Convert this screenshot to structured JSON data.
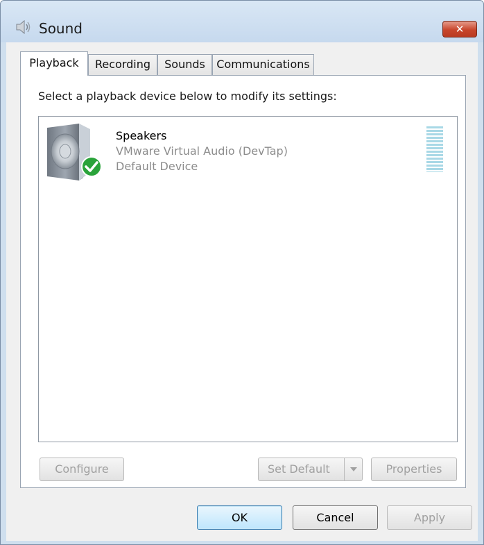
{
  "window": {
    "title": "Sound",
    "close_glyph": "✕"
  },
  "tabs": [
    {
      "label": "Playback",
      "active": true
    },
    {
      "label": "Recording",
      "active": false
    },
    {
      "label": "Sounds",
      "active": false
    },
    {
      "label": "Communications",
      "active": false
    }
  ],
  "playback": {
    "instruction": "Select a playback device below to modify its settings:",
    "devices": [
      {
        "name": "Speakers",
        "description": "VMware Virtual Audio (DevTap)",
        "status": "Default Device",
        "icon": "speaker-icon",
        "status_icon": "green-checkmark-icon"
      }
    ],
    "buttons": {
      "configure": "Configure",
      "set_default": "Set Default",
      "properties": "Properties"
    }
  },
  "dialog_buttons": {
    "ok": "OK",
    "cancel": "Cancel",
    "apply": "Apply"
  },
  "colors": {
    "title_bar": "#c6d9ee",
    "close_button": "#c8462c",
    "check_green": "#2aa33a",
    "level_meter": "#a8d8e6",
    "disabled_text": "#a0a0a0"
  }
}
